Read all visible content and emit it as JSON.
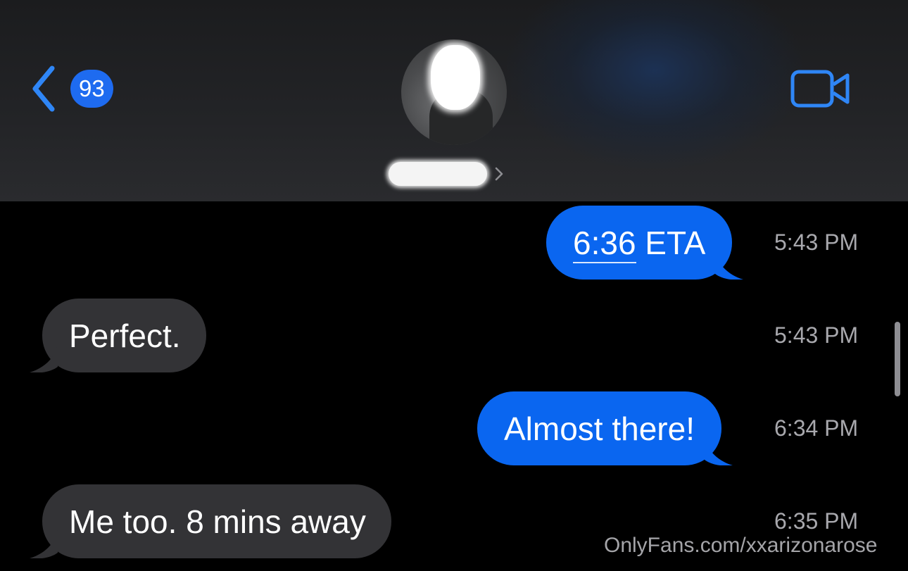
{
  "header": {
    "unread_count": "93",
    "back_icon": "chevron-left-icon",
    "video_icon": "video-camera-icon",
    "name_chevron_icon": "chevron-right-icon",
    "accent_color": "#1e6bf0"
  },
  "messages": [
    {
      "direction": "sent",
      "text_link": "6:36",
      "text_rest": " ETA",
      "time": "5:43 PM"
    },
    {
      "direction": "received",
      "text": "Perfect.",
      "time": "5:43 PM"
    },
    {
      "direction": "sent",
      "text": "Almost there!",
      "time": "6:34 PM"
    },
    {
      "direction": "received",
      "text": "Me too. 8 mins away",
      "time": "6:35 PM"
    }
  ],
  "colors": {
    "sent_bubble": "#0a66f0",
    "received_bubble": "#333336",
    "timestamp": "#a8a8ad"
  },
  "watermark": "OnlyFans.com/xxarizonarose"
}
